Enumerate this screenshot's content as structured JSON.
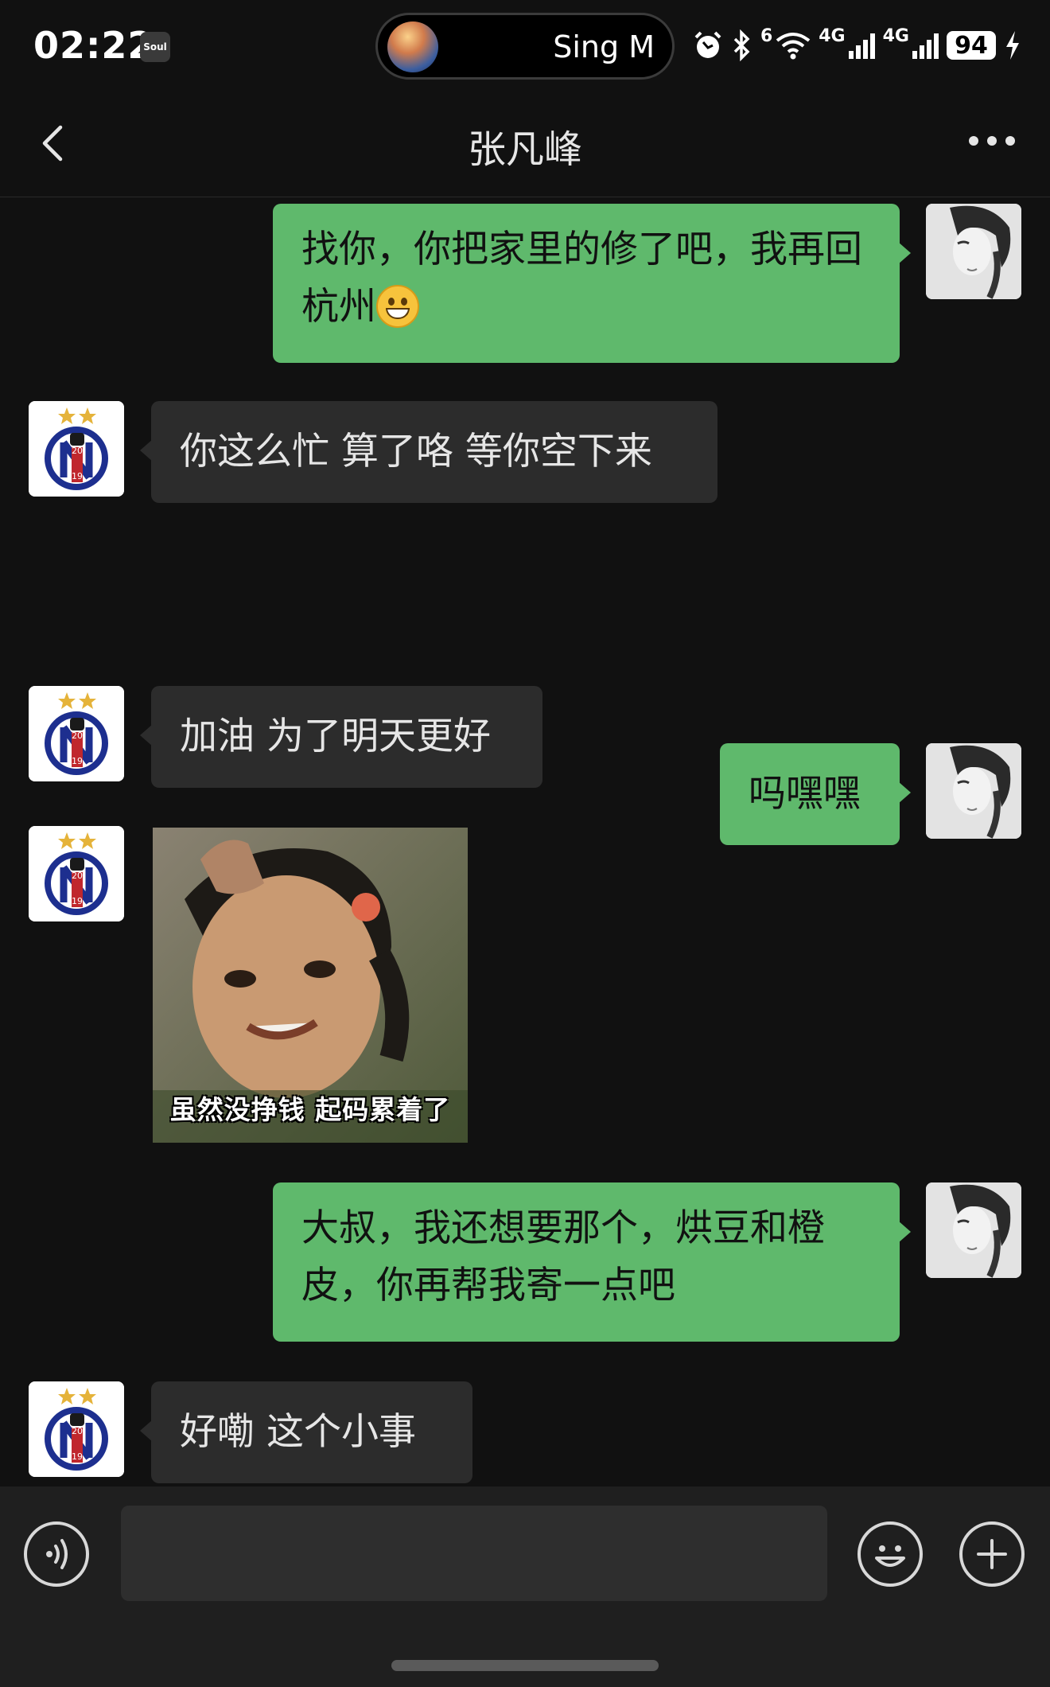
{
  "status_bar": {
    "time": "02:22",
    "app_badge": "Soul",
    "now_playing": "Sing M",
    "network_1": "6",
    "network_2": "4G",
    "network_3": "4G",
    "battery": "94"
  },
  "header": {
    "title": "张凡峰"
  },
  "messages": [
    {
      "from": "self",
      "text": "找你，你把家里的修了吧，我再回杭州",
      "emoji": "grinning-face-emoji"
    },
    {
      "from": "other",
      "text": "你这么忙 算了咯 等你空下来"
    },
    {
      "from": "self",
      "text": "吗嘿嘿"
    },
    {
      "from": "other",
      "text": "加油 为了明天更好"
    },
    {
      "from": "other",
      "type": "sticker",
      "caption": "虽然没挣钱 起码累着了"
    },
    {
      "from": "self",
      "text": "大叔，我还想要那个，烘豆和橙皮，你再帮我寄一点吧"
    },
    {
      "from": "other",
      "text": "好嘞 这个小事"
    }
  ],
  "contact_avatar": {
    "badge_number_top": "20",
    "badge_number_bottom": "19"
  },
  "input": {
    "value": ""
  },
  "colors": {
    "background": "#111111",
    "outgoing_bubble": "#5fb96c",
    "incoming_bubble": "#2c2c2c",
    "input_bar": "#1f1f1f"
  }
}
